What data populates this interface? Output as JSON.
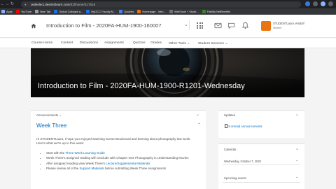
{
  "browser": {
    "url_host": "owlselect.desire2learn.com",
    "url_path": "/d2l/home/317616"
  },
  "bookmarks": [
    {
      "label": "Apps",
      "color": "#8ab4f8"
    },
    {
      "label": "YouTube",
      "color": "#ff0000"
    },
    {
      "label": "New Tab",
      "color": "#9aa0a6"
    },
    {
      "label": "Global Colleges a...",
      "color": "#1a73e8"
    },
    {
      "label": "MyGCC Faculty M...",
      "color": "#1a73e8"
    },
    {
      "label": "Quizlets",
      "color": "#4285f4"
    },
    {
      "label": "Homepage - Intro...",
      "color": "#e87511"
    },
    {
      "label": "WebTools + Stude...",
      "color": "#6e7376"
    },
    {
      "label": "Fidelity NetBenefits",
      "color": "#368727"
    }
  ],
  "header": {
    "course_title": "Introduction to Film - 2020FA-HUM-1900-160007",
    "user_name": "STUDENTLaura Vendolf",
    "user_role": "Student"
  },
  "nav": {
    "items": [
      "Course Home",
      "Content",
      "Discussions",
      "Assignments",
      "Quizzes",
      "Grades",
      "Other Tools ⌄",
      "Student Services ⌄"
    ]
  },
  "banner": {
    "title": "Introduction to Film - 2020FA-HUM-1900-R1201-Wednesday"
  },
  "announcements": {
    "header": "Announcements ⌄",
    "item_title": "Week Three",
    "intro": "Hi STUDENTLaura, I hope you enjoyed watching Sunset Boulevard and learning about photography last week. Here's what we're up to this week:",
    "bullets": [
      {
        "pre": "Start with the ",
        "link": "Three Week Learning Guide",
        "post": ""
      },
      {
        "pre": "Week Three's assigned reading will conclude with Chapter One Photography in Understanding Movies",
        "link": "",
        "post": ""
      },
      {
        "pre": "After assigned reading view Week Three's ",
        "link": "Lecture/Supplemental Materials",
        "post": ""
      },
      {
        "pre": "Please review all of the ",
        "link": "Support Materials",
        "post": " before submitting Week Three Assignments"
      }
    ]
  },
  "updates": {
    "header": "Updates",
    "count": "3",
    "label": "Unread Announcements"
  },
  "calendar": {
    "header": "Calendar",
    "date": "Wednesday, October 7, 2020",
    "upcoming": "Upcoming events"
  },
  "colors": {
    "accent": "#006fbf",
    "user_badge": "#e87511"
  }
}
